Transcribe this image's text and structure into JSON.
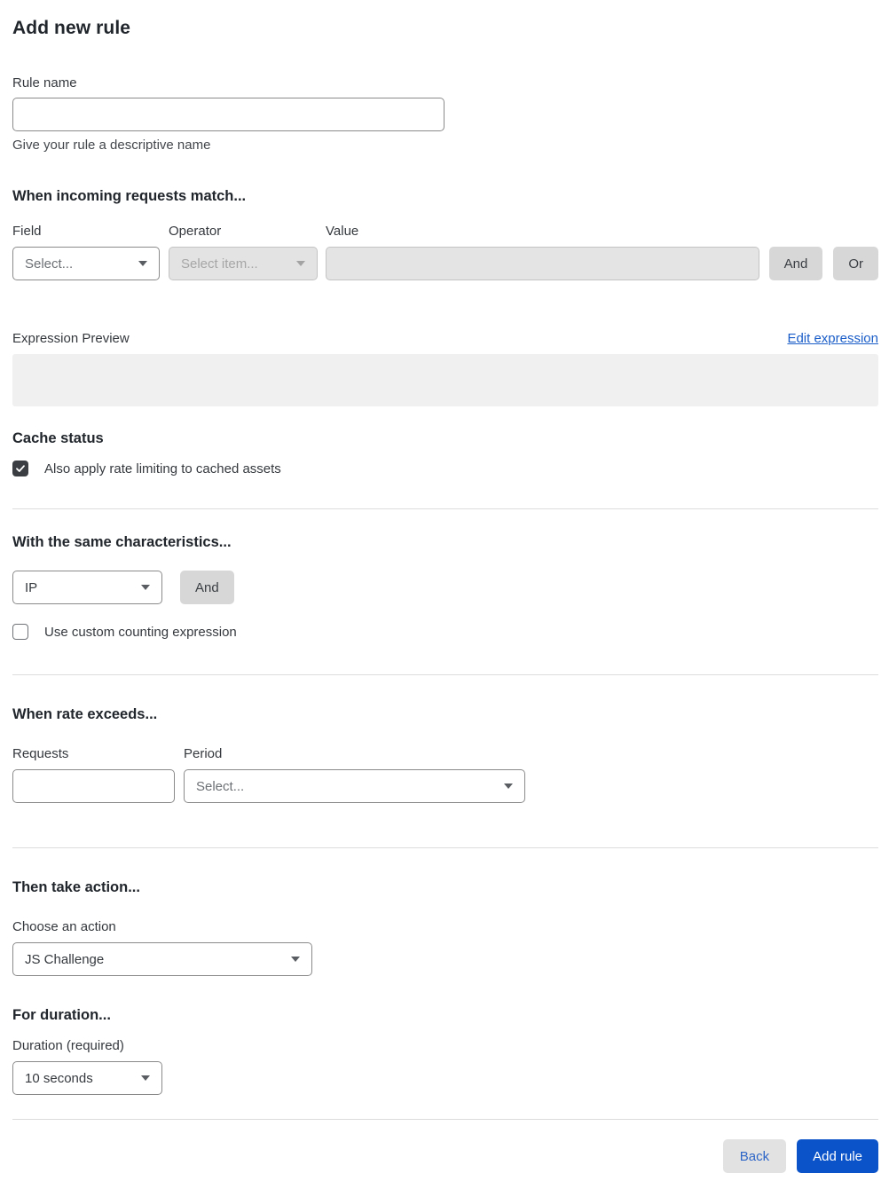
{
  "page": {
    "title": "Add new rule"
  },
  "rule_name": {
    "label": "Rule name",
    "value": "",
    "helper": "Give your rule a descriptive name"
  },
  "match": {
    "heading": "When incoming requests match...",
    "field": {
      "label": "Field",
      "selected": "Select..."
    },
    "operator": {
      "label": "Operator",
      "selected": "Select item...",
      "disabled": true
    },
    "value": {
      "label": "Value",
      "value": "",
      "disabled": true
    },
    "and_label": "And",
    "or_label": "Or",
    "expression_preview_label": "Expression Preview",
    "edit_expression_label": "Edit expression",
    "expression_value": ""
  },
  "cache": {
    "heading": "Cache status",
    "checkbox_label": "Also apply rate limiting to cached assets",
    "checked": true
  },
  "characteristics": {
    "heading": "With the same characteristics...",
    "selected": "IP",
    "and_label": "And",
    "checkbox_label": "Use custom counting expression",
    "checked": false
  },
  "rate": {
    "heading": "When rate exceeds...",
    "requests_label": "Requests",
    "requests_value": "",
    "period_label": "Period",
    "period_selected": "Select..."
  },
  "action": {
    "heading": "Then take action...",
    "label": "Choose an action",
    "selected": "JS Challenge"
  },
  "duration": {
    "heading": "For duration...",
    "label": "Duration (required)",
    "selected": "10 seconds"
  },
  "footer": {
    "back_label": "Back",
    "add_label": "Add rule"
  },
  "colors": {
    "primary_button": "#0a53c8",
    "link": "#1a5dc8",
    "checked_checkbox": "#3a3e43",
    "disabled_field_bg": "#e3e3e3",
    "preview_box_bg": "#f0f0f0"
  }
}
